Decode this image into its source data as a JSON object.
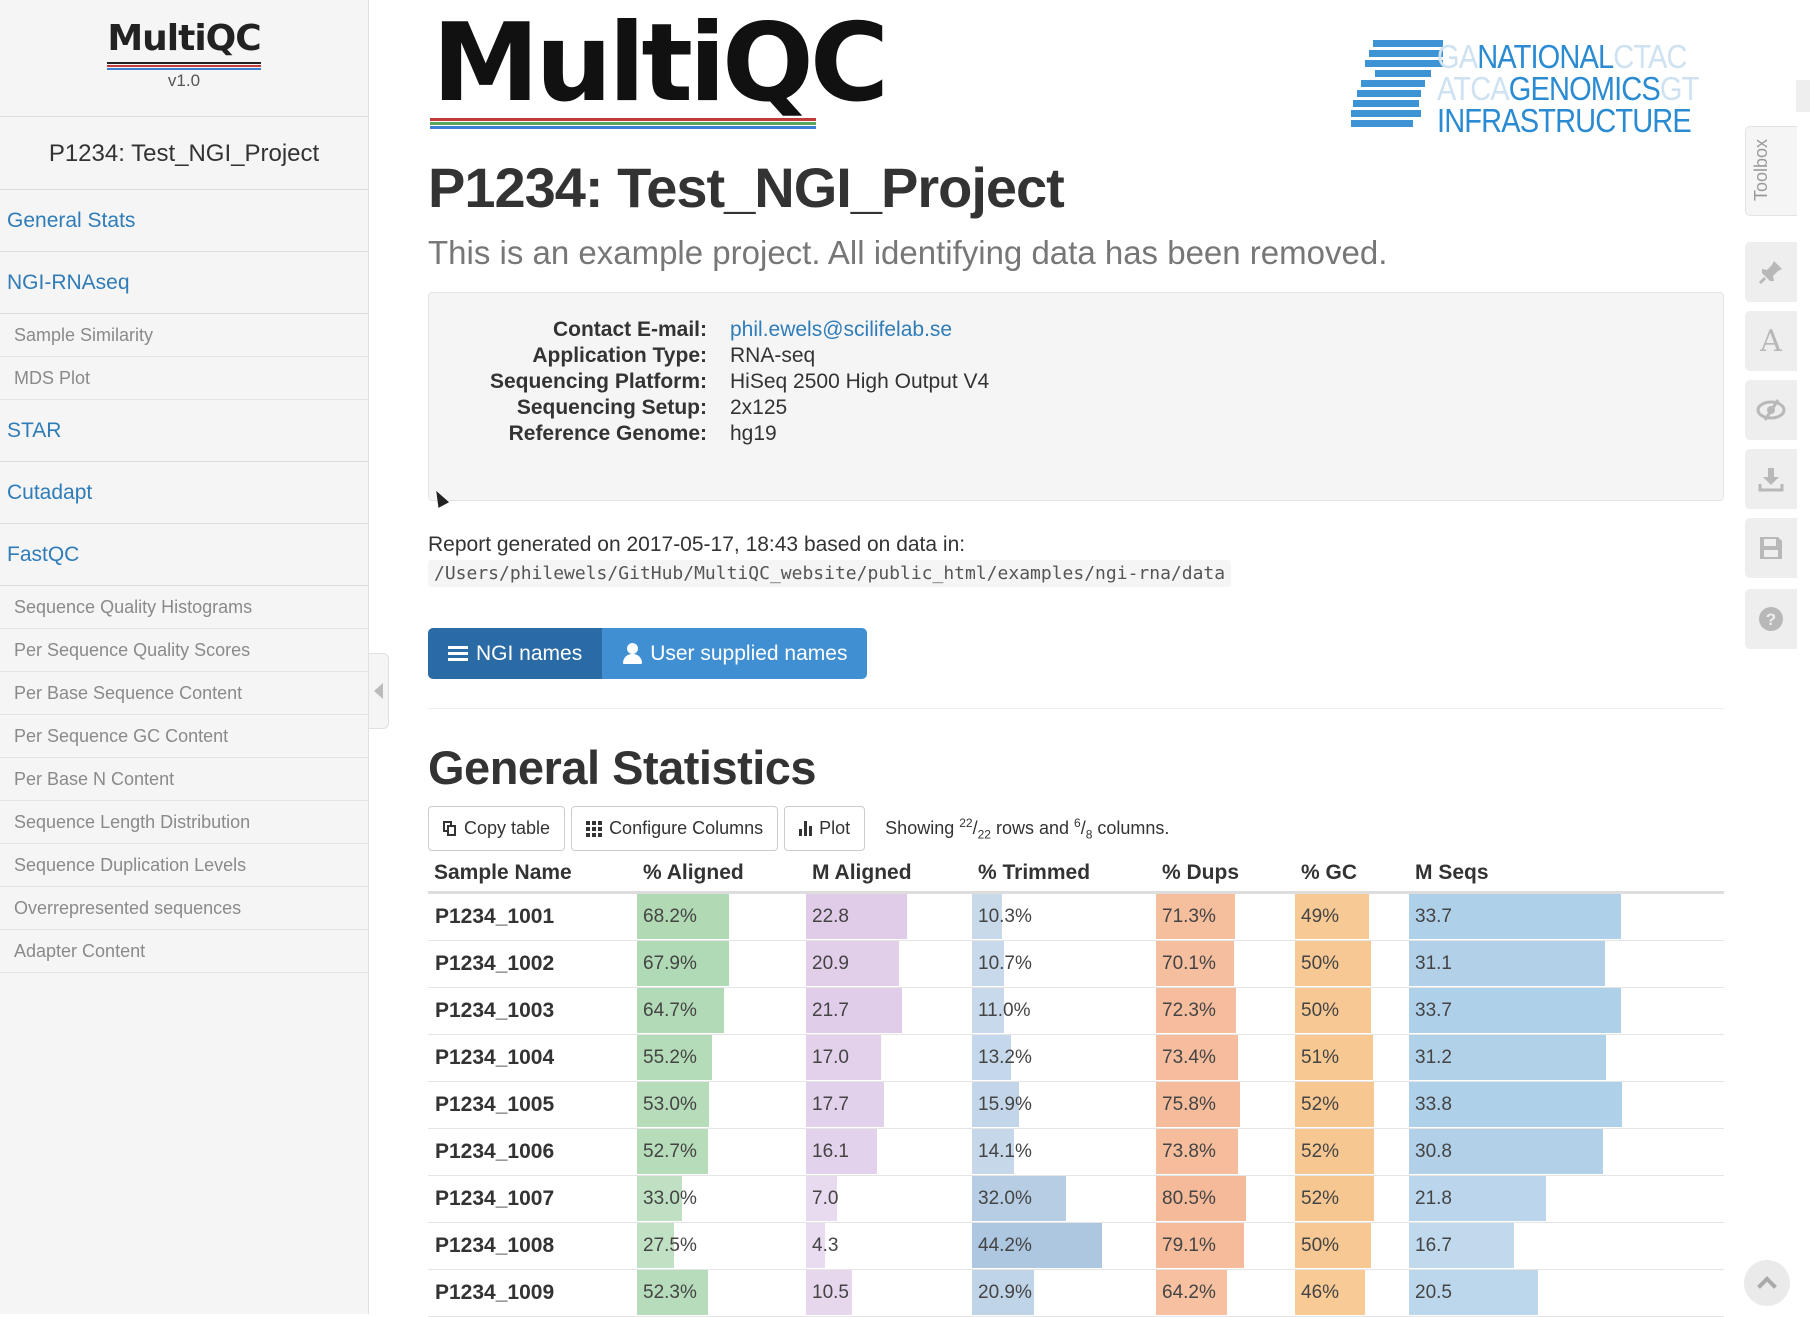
{
  "sidebar": {
    "logo_text": "MultiQC",
    "version": "v1.0",
    "project": "P1234: Test_NGI_Project",
    "nav": [
      {
        "label": "General Stats",
        "level": "top"
      },
      {
        "label": "NGI-RNAseq",
        "level": "top"
      },
      {
        "label": "Sample Similarity",
        "level": "sub"
      },
      {
        "label": "MDS Plot",
        "level": "sub"
      },
      {
        "label": "STAR",
        "level": "top"
      },
      {
        "label": "Cutadapt",
        "level": "top"
      },
      {
        "label": "FastQC",
        "level": "top"
      },
      {
        "label": "Sequence Quality Histograms",
        "level": "sub"
      },
      {
        "label": "Per Sequence Quality Scores",
        "level": "sub"
      },
      {
        "label": "Per Base Sequence Content",
        "level": "sub"
      },
      {
        "label": "Per Sequence GC Content",
        "level": "sub"
      },
      {
        "label": "Per Base N Content",
        "level": "sub"
      },
      {
        "label": "Sequence Length Distribution",
        "level": "sub"
      },
      {
        "label": "Sequence Duplication Levels",
        "level": "sub"
      },
      {
        "label": "Overrepresented sequences",
        "level": "sub"
      },
      {
        "label": "Adapter Content",
        "level": "sub"
      }
    ]
  },
  "header": {
    "logo_text": "MultiQC",
    "ngi_logo": {
      "line1_faint_left": "GA",
      "line1_strong": "NATIONAL",
      "line1_faint_right": "CTAC",
      "line2_faint_left": "ATCA",
      "line2_strong": "GENOMICS",
      "line2_faint_right": "GT",
      "line3_strong": "INFRASTRUCTURE"
    },
    "title": "P1234: Test_NGI_Project",
    "subtitle": "This is an example project. All identifying data has been removed."
  },
  "project_info": [
    {
      "key": "Contact E-mail:",
      "value": "phil.ewels@scilifelab.se",
      "link": true
    },
    {
      "key": "Application Type:",
      "value": "RNA-seq",
      "link": false
    },
    {
      "key": "Sequencing Platform:",
      "value": "HiSeq 2500 High Output V4",
      "link": false
    },
    {
      "key": "Sequencing Setup:",
      "value": "2x125",
      "link": false
    },
    {
      "key": "Reference Genome:",
      "value": "hg19",
      "link": false
    }
  ],
  "report": {
    "generated": "Report generated on 2017-05-17, 18:43 based on data in:",
    "path": "/Users/philewels/GitHub/MultiQC_website/public_html/examples/ngi-rna/data"
  },
  "name_buttons": {
    "ngi": "NGI names",
    "user": "User supplied names"
  },
  "general_stats": {
    "title": "General Statistics",
    "toolbar": {
      "copy": "Copy table",
      "configure": "Configure Columns",
      "plot": "Plot"
    },
    "showing": {
      "prefix": "Showing ",
      "rows_shown": "22",
      "rows_total": "22",
      "middle": " rows and ",
      "cols_shown": "6",
      "cols_total": "8",
      "suffix": " columns."
    },
    "columns": [
      "Sample Name",
      "% Aligned",
      "M Aligned",
      "% Trimmed",
      "% Dups",
      "% GC",
      "M Seqs"
    ],
    "column_max": [
      null,
      100,
      30,
      50,
      100,
      60,
      40
    ],
    "column_colors": [
      null,
      "#a3d3a8",
      "#dcc6e6",
      "#a9c4df",
      "#f4b48f",
      "#f6c48a",
      "#a9cce7"
    ],
    "rows": [
      [
        "P1234_1001",
        "68.2%",
        "22.8",
        "10.3%",
        "71.3%",
        "49%",
        "33.7"
      ],
      [
        "P1234_1002",
        "67.9%",
        "20.9",
        "10.7%",
        "70.1%",
        "50%",
        "31.1"
      ],
      [
        "P1234_1003",
        "64.7%",
        "21.7",
        "11.0%",
        "72.3%",
        "50%",
        "33.7"
      ],
      [
        "P1234_1004",
        "55.2%",
        "17.0",
        "13.2%",
        "73.4%",
        "51%",
        "31.2"
      ],
      [
        "P1234_1005",
        "53.0%",
        "17.7",
        "15.9%",
        "75.8%",
        "52%",
        "33.8"
      ],
      [
        "P1234_1006",
        "52.7%",
        "16.1",
        "14.1%",
        "73.8%",
        "52%",
        "30.8"
      ],
      [
        "P1234_1007",
        "33.0%",
        "7.0",
        "32.0%",
        "80.5%",
        "52%",
        "21.8"
      ],
      [
        "P1234_1008",
        "27.5%",
        "4.3",
        "44.2%",
        "79.1%",
        "50%",
        "16.7"
      ],
      [
        "P1234_1009",
        "52.3%",
        "10.5",
        "20.9%",
        "64.2%",
        "46%",
        "20.5"
      ]
    ]
  },
  "toolbox": {
    "label": "Toolbox"
  },
  "colors": {
    "link": "#2f7cb8",
    "btn_active": "#2a6aa5",
    "btn": "#3f8fd2",
    "ngi_blue": "#2a8bd2"
  }
}
